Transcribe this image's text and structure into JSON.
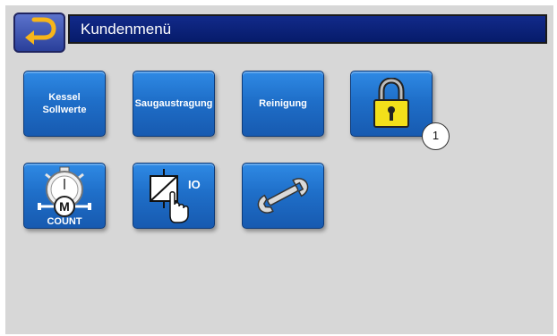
{
  "header": {
    "title": "Kundenmenü",
    "back_icon": "return-arrow-icon"
  },
  "tiles": {
    "kessel_sollwerte": {
      "label": "Kessel\nSollwerte"
    },
    "saugaustragung": {
      "label": "Saugaustragung"
    },
    "reinigung": {
      "label": "Reinigung"
    },
    "lock": {
      "icon": "padlock-icon"
    },
    "motor_count": {
      "icon": "stopwatch-motor-icon",
      "label": "COUNT",
      "letter": "M"
    },
    "manual_io": {
      "icon": "relay-hand-icon",
      "label": "IO"
    },
    "service": {
      "icon": "wrench-icon"
    }
  },
  "annotations": {
    "callout_1": "1"
  },
  "colors": {
    "tile": "#1f6fc9",
    "title_bar": "#0a1f78",
    "background": "#d7d7d7"
  }
}
